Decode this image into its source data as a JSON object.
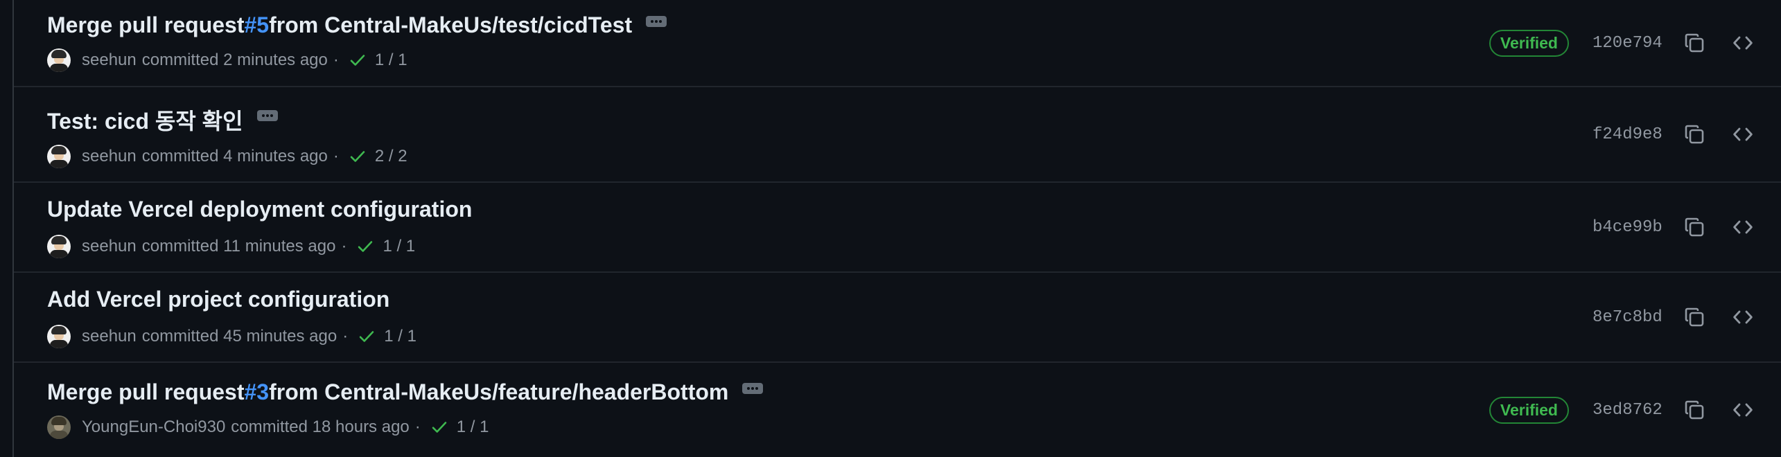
{
  "colors": {
    "background": "#0d1117",
    "title": "#e6edf3",
    "muted": "#9198a1",
    "link": "#4493f8",
    "success": "#3fb950",
    "border": "#21262d"
  },
  "icons": {
    "check": "check-icon",
    "copy": "copy-icon",
    "browse": "code-icon",
    "more": "ellipsis-icon"
  },
  "commits": [
    {
      "title_prefix": "Merge pull request ",
      "pr": "#5",
      "title_suffix": " from Central-MakeUs/test/cicdTest",
      "has_ellipsis": true,
      "author": "seehun",
      "committed_text": "committed 2 minutes ago",
      "checks": "1 / 1",
      "verified": "Verified",
      "sha": "120e794"
    },
    {
      "title_prefix": "Test: cicd 동작 확인",
      "pr": "",
      "title_suffix": "",
      "has_ellipsis": true,
      "author": "seehun",
      "committed_text": "committed 4 minutes ago",
      "checks": "2 / 2",
      "verified": "",
      "sha": "f24d9e8"
    },
    {
      "title_prefix": "Update Vercel deployment configuration",
      "pr": "",
      "title_suffix": "",
      "has_ellipsis": false,
      "author": "seehun",
      "committed_text": "committed 11 minutes ago",
      "checks": "1 / 1",
      "verified": "",
      "sha": "b4ce99b"
    },
    {
      "title_prefix": "Add Vercel project configuration",
      "pr": "",
      "title_suffix": "",
      "has_ellipsis": false,
      "author": "seehun",
      "committed_text": "committed 45 minutes ago",
      "checks": "1 / 1",
      "verified": "",
      "sha": "8e7c8bd"
    },
    {
      "title_prefix": "Merge pull request ",
      "pr": "#3",
      "title_suffix": " from Central-MakeUs/feature/headerBottom",
      "has_ellipsis": true,
      "author": "YoungEun-Choi930",
      "committed_text": "committed 18 hours ago",
      "checks": "1 / 1",
      "verified": "Verified",
      "sha": "3ed8762"
    }
  ]
}
